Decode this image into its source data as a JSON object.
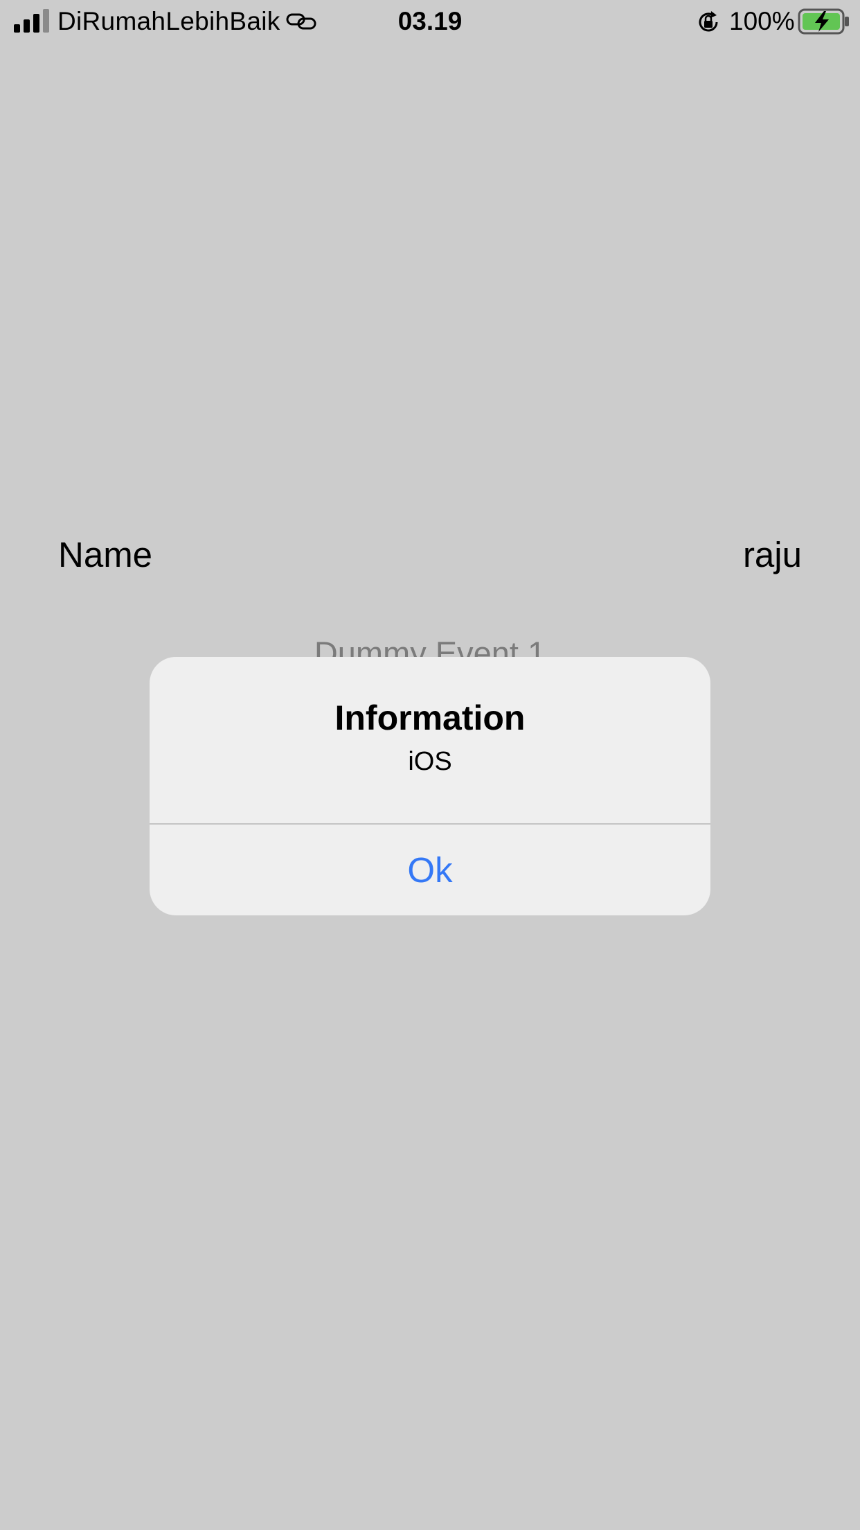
{
  "status_bar": {
    "carrier": "DiRumahLebihBaik",
    "time": "03.19",
    "battery_percent": "100%",
    "signal_bars_filled": 3,
    "signal_bars_total": 4,
    "icons": [
      "signal-icon",
      "link-icon",
      "lock-rotation-icon",
      "battery-charging-icon"
    ],
    "battery_color": "#62c554"
  },
  "background": {
    "name_label": "Name",
    "name_value": "raju",
    "event_title": "Dummy Event 1"
  },
  "alert": {
    "title": "Information",
    "message": "iOS",
    "ok_label": "Ok",
    "ok_color": "#3478f6"
  },
  "colors": {
    "dim_background": "#cccccc",
    "alert_background": "#efefef"
  }
}
